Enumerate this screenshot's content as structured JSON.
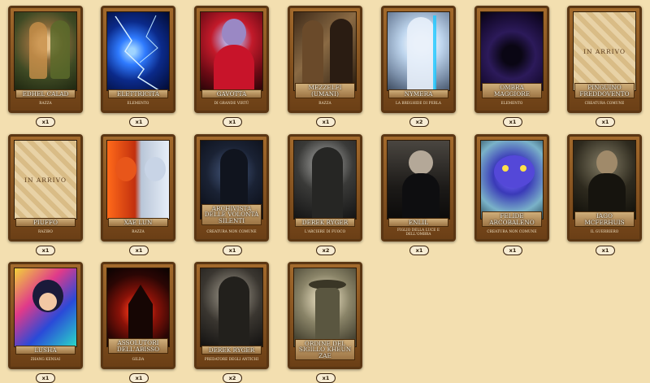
{
  "placeholder_text": "IN ARRIVO",
  "cards": [
    {
      "name": "EDHEL CALAD",
      "subtitle": "RAZZA",
      "count": "x1"
    },
    {
      "name": "ELETTRICITÀ",
      "subtitle": "ELEMENTO",
      "count": "x1"
    },
    {
      "name": "GAVOTTA",
      "subtitle": "DI GRANDE VIRTÙ",
      "count": "x1"
    },
    {
      "name": "MEZZELFI (UMANI)",
      "subtitle": "RAZZA",
      "count": "x1"
    },
    {
      "name": "NYMERA",
      "subtitle": "LA BREGHIDE DI PERLA",
      "count": "x2"
    },
    {
      "name": "OMBRA MAGGIORE",
      "subtitle": "ELEMENTO",
      "count": "x1"
    },
    {
      "name": "PINGUINO FREDDOVENTO",
      "subtitle": "CREATURA COMUNE",
      "count": "x1"
    },
    {
      "name": "PIUFFO",
      "subtitle": "RAZIBO",
      "count": "x1"
    },
    {
      "name": "XAE LUN",
      "subtitle": "RAZZA",
      "count": "x1"
    },
    {
      "name": "ARCHIVISTA DELLE VOLONTÀ SILENTI",
      "subtitle": "CREATURA NON COMUNE",
      "count": "x1"
    },
    {
      "name": "DEREK RYGER",
      "subtitle": "L'ARCIERE DI FUOCO",
      "count": "x2"
    },
    {
      "name": "ENLIL",
      "subtitle": "FIGLIO DELLA LUCE E DELL'OMBRA",
      "count": "x1"
    },
    {
      "name": "FELIDE ARCOBALENO",
      "subtitle": "CREATURA NON COMUNE",
      "count": "x1"
    },
    {
      "name": "IAGO MCFERHUIS",
      "subtitle": "IL GUERRIERO",
      "count": "x1"
    },
    {
      "name": "LUSHA",
      "subtitle": "ZHANG KENSAI",
      "count": "x1"
    },
    {
      "name": "ASSOLUTORI DELL'ABISSO",
      "subtitle": "GILDA",
      "count": "x1"
    },
    {
      "name": "DEREK RYGER",
      "subtitle": "PREDATORE DEGLI ANTICHI",
      "count": "x2"
    },
    {
      "name": "ORDINE DEL SIGILLO KHEUN ZAE",
      "subtitle": "",
      "count": "x1"
    }
  ]
}
